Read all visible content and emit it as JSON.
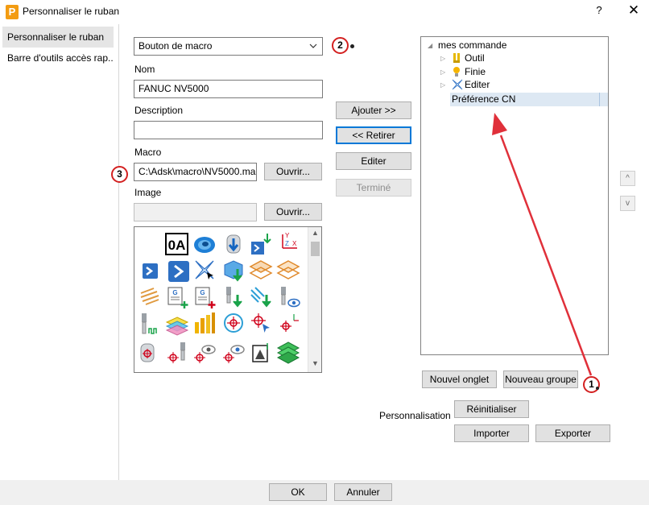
{
  "window": {
    "title": "Personnaliser le ruban",
    "app_icon_letter": "P",
    "help": "?",
    "close": "✕"
  },
  "nav": {
    "items": [
      {
        "label": "Personnaliser le ruban",
        "selected": true
      },
      {
        "label": "Barre d'outils accès rap..."
      }
    ]
  },
  "form": {
    "type_value": "Bouton de macro",
    "name_label": "Nom",
    "name_value": "FANUC NV5000",
    "description_label": "Description",
    "description_value": "",
    "macro_label": "Macro",
    "macro_value": "C:\\Adsk\\macro\\NV5000.ma",
    "image_label": "Image",
    "image_value": "",
    "browse_macro": "Ouvrir...",
    "browse_image": "Ouvrir..."
  },
  "actions": {
    "add": "Ajouter >>",
    "remove": "<< Retirer",
    "edit": "Editer",
    "done": "Terminé"
  },
  "tree": {
    "root": "mes commande",
    "items": [
      {
        "label": "Outil",
        "icon": "tool-icon"
      },
      {
        "label": "Finie",
        "icon": "bulb-icon"
      },
      {
        "label": "Editer",
        "icon": "edit-icon"
      }
    ],
    "selected": "Préférence CN"
  },
  "tree_buttons": {
    "new_tab": "Nouvel onglet",
    "new_group": "Nouveau groupe",
    "up": "^",
    "down": "v"
  },
  "customization": {
    "label": "Personnalisation",
    "reset": "Réinitialiser",
    "import": "Importer",
    "export": "Exporter"
  },
  "footer": {
    "ok": "OK",
    "cancel": "Annuler"
  },
  "annotations": {
    "badge_1": "1",
    "badge_2": "2",
    "badge_3": "3",
    "color": "#d32020"
  },
  "icons": {
    "ribbon_icon_text": "0A",
    "g_code_label": "G"
  }
}
